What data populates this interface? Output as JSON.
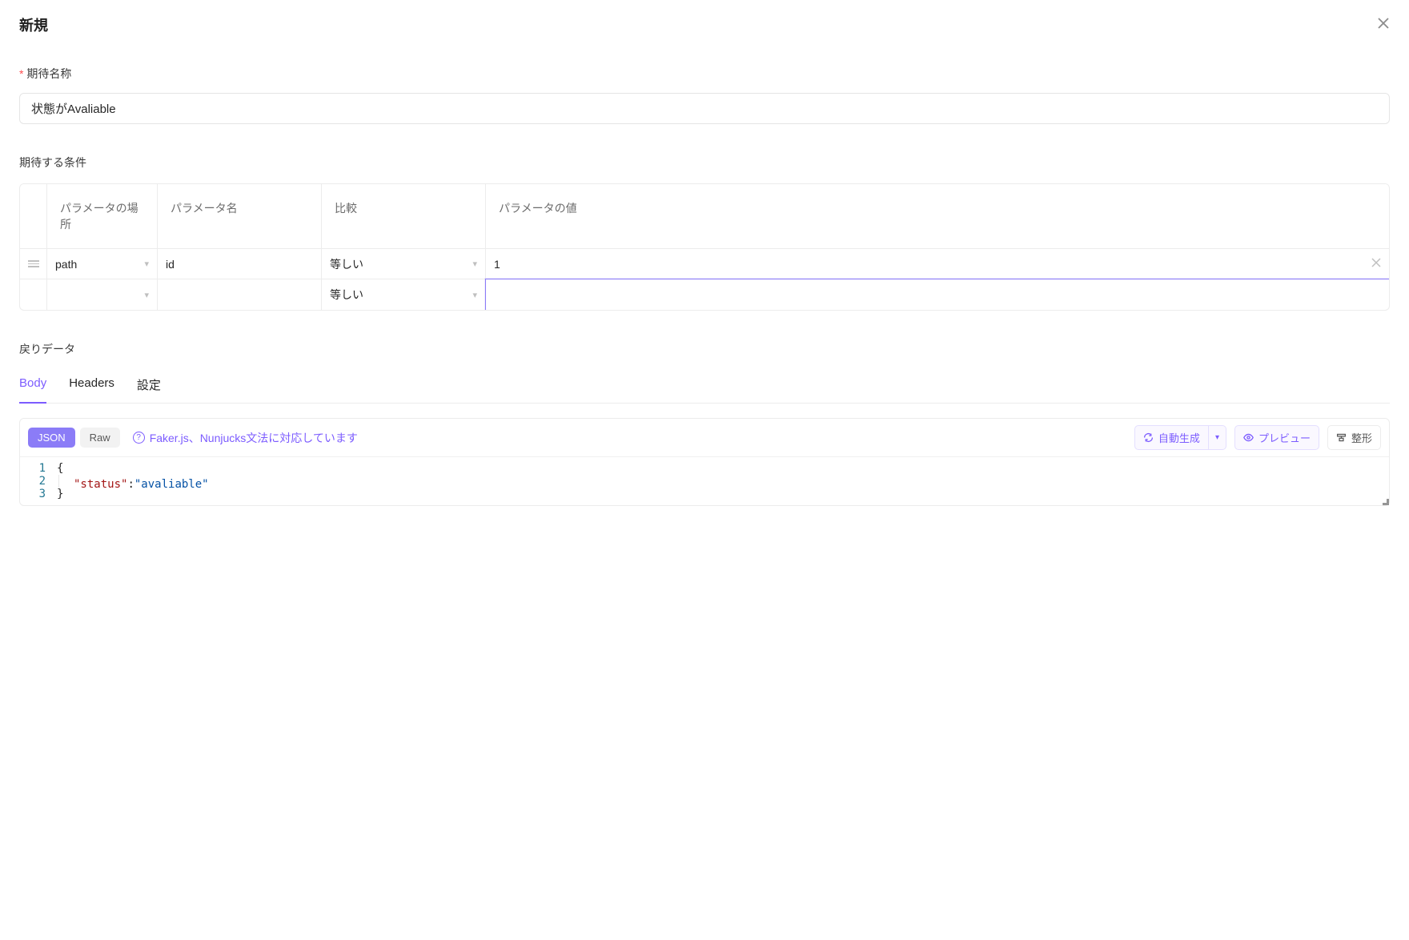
{
  "modal": {
    "title": "新規"
  },
  "fields": {
    "name_label": "期待名称",
    "name_value": "状態がAvaliable",
    "conditions_label": "期待する条件",
    "return_label": "戻りデータ"
  },
  "cond_table": {
    "headers": {
      "location": "パラメータの場所",
      "name": "パラメータ名",
      "compare": "比較",
      "value": "パラメータの値"
    },
    "rows": [
      {
        "location": "path",
        "name": "id",
        "compare": "等しい",
        "value": "1",
        "has_handle": true,
        "has_delete": true
      },
      {
        "location": "",
        "name": "",
        "compare": "等しい",
        "value": "",
        "has_handle": false,
        "has_delete": false,
        "focused": true
      }
    ]
  },
  "tabs": {
    "body": "Body",
    "headers": "Headers",
    "settings": "設定"
  },
  "body_panel": {
    "seg_json": "JSON",
    "seg_raw": "Raw",
    "help_text": "Faker.js、Nunjucks文法に対応しています",
    "autogen": "自動生成",
    "preview": "プレビュー",
    "format": "整形",
    "code": {
      "lines": [
        {
          "n": "1",
          "content": "{"
        },
        {
          "n": "2",
          "key": "\"status\"",
          "sep": ":",
          "val": "\"avaliable\""
        },
        {
          "n": "3",
          "content": "}"
        }
      ]
    }
  }
}
